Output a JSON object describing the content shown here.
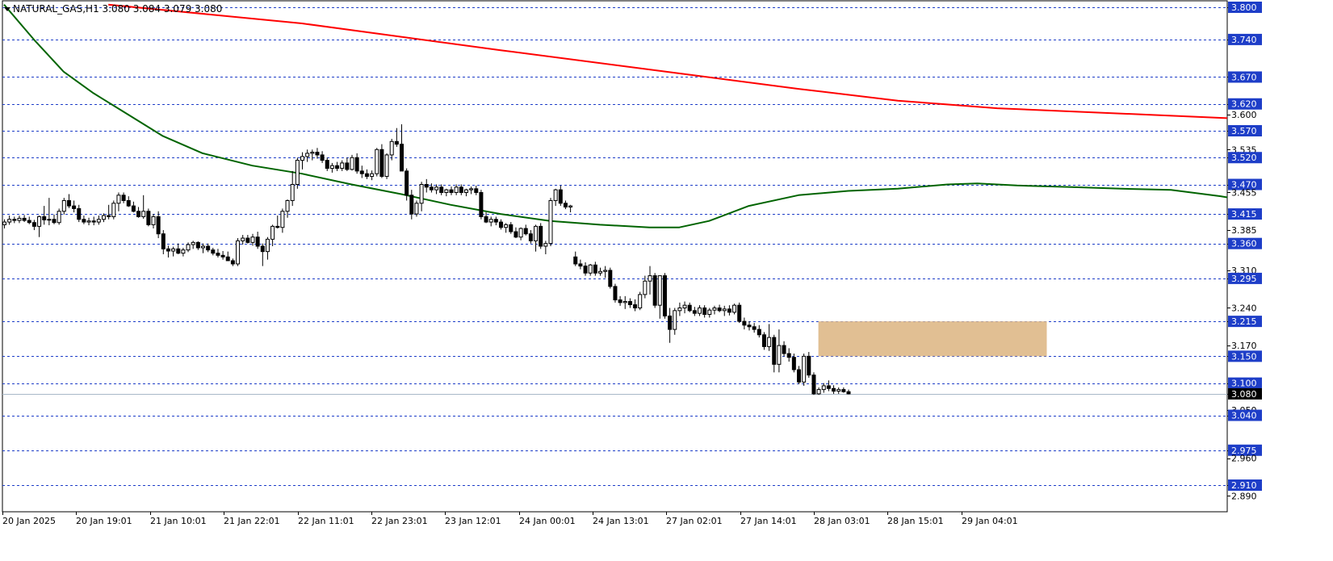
{
  "chart_data": {
    "type": "candlestick",
    "title": "NATURAL_GAS,H1",
    "ohlc_header": "3.080 3.084 3.079 3.080",
    "title_text": "NATURAL_GAS,H1  3.080 3.084 3.079 3.080",
    "ylim": [
      2.87,
      3.805
    ],
    "y_ticks": [
      "3.800",
      "3.740",
      "3.670",
      "3.620",
      "3.600",
      "3.570",
      "3.535",
      "3.520",
      "3.470",
      "3.455",
      "3.415",
      "3.385",
      "3.360",
      "3.310",
      "3.295",
      "3.240",
      "3.215",
      "3.170",
      "3.150",
      "3.100",
      "3.080",
      "3.050",
      "3.040",
      "2.975",
      "2.960",
      "2.910",
      "2.890"
    ],
    "level_lines": [
      "3.800",
      "3.740",
      "3.670",
      "3.620",
      "3.570",
      "3.520",
      "3.470",
      "3.415",
      "3.360",
      "3.295",
      "3.215",
      "3.150",
      "3.100",
      "3.040",
      "2.975",
      "2.910"
    ],
    "current_price": "3.080",
    "x_labels": [
      "20 Jan 2025",
      "20 Jan 19:01",
      "21 Jan 10:01",
      "21 Jan 22:01",
      "22 Jan 11:01",
      "22 Jan 23:01",
      "23 Jan 12:01",
      "24 Jan 00:01",
      "24 Jan 13:01",
      "27 Jan 02:01",
      "27 Jan 14:01",
      "28 Jan 03:01",
      "28 Jan 15:01",
      "29 Jan 04:01"
    ],
    "zone": {
      "low": 3.15,
      "high": 3.215,
      "start_bar": 164,
      "end_bar": 210,
      "color": "#deb887"
    },
    "series": [
      {
        "name": "",
        "color": "#ff0000",
        "role": "slow-moving-average",
        "points": [
          [
            21,
            3.805
          ],
          [
            60,
            3.77
          ],
          [
            100,
            3.72
          ],
          [
            140,
            3.672
          ],
          [
            160,
            3.648
          ],
          [
            180,
            3.626
          ],
          [
            200,
            3.612
          ],
          [
            230,
            3.6
          ],
          [
            260,
            3.588
          ],
          [
            300,
            3.575
          ],
          [
            340,
            3.56
          ],
          [
            380,
            3.543
          ],
          [
            410,
            3.53
          ],
          [
            430,
            3.512
          ],
          [
            460,
            3.49
          ],
          [
            480,
            3.475
          ],
          [
            500,
            3.462
          ],
          [
            520,
            3.45
          ],
          [
            560,
            3.426
          ],
          [
            600,
            3.4
          ],
          [
            640,
            3.37
          ]
        ]
      },
      {
        "name": "",
        "color": "#006400",
        "role": "fast-moving-average",
        "points": [
          [
            0,
            3.805
          ],
          [
            6,
            3.74
          ],
          [
            12,
            3.68
          ],
          [
            18,
            3.64
          ],
          [
            25,
            3.6
          ],
          [
            32,
            3.56
          ],
          [
            40,
            3.528
          ],
          [
            50,
            3.505
          ],
          [
            60,
            3.49
          ],
          [
            70,
            3.47
          ],
          [
            80,
            3.452
          ],
          [
            90,
            3.432
          ],
          [
            100,
            3.415
          ],
          [
            110,
            3.402
          ],
          [
            120,
            3.395
          ],
          [
            130,
            3.39
          ],
          [
            136,
            3.39
          ],
          [
            142,
            3.402
          ],
          [
            150,
            3.43
          ],
          [
            160,
            3.45
          ],
          [
            170,
            3.458
          ],
          [
            180,
            3.462
          ],
          [
            190,
            3.47
          ],
          [
            196,
            3.472
          ],
          [
            204,
            3.468
          ],
          [
            215,
            3.465
          ],
          [
            225,
            3.462
          ],
          [
            235,
            3.46
          ],
          [
            245,
            3.448
          ],
          [
            255,
            3.432
          ],
          [
            262,
            3.42
          ],
          [
            270,
            3.418
          ],
          [
            280,
            3.4
          ],
          [
            290,
            3.382
          ],
          [
            300,
            3.36
          ],
          [
            310,
            3.332
          ],
          [
            320,
            3.31
          ],
          [
            330,
            3.292
          ],
          [
            340,
            3.28
          ],
          [
            350,
            3.262
          ],
          [
            360,
            3.248
          ],
          [
            370,
            3.228
          ],
          [
            380,
            3.205
          ],
          [
            390,
            3.18
          ],
          [
            400,
            3.16
          ]
        ]
      }
    ],
    "candles": [
      [
        3.395,
        3.405,
        3.388,
        3.4
      ],
      [
        3.4,
        3.412,
        3.395,
        3.405
      ],
      [
        3.405,
        3.41,
        3.398,
        3.403
      ],
      [
        3.403,
        3.412,
        3.398,
        3.407
      ],
      [
        3.407,
        3.413,
        3.4,
        3.403
      ],
      [
        3.403,
        3.41,
        3.396,
        3.399
      ],
      [
        3.399,
        3.404,
        3.385,
        3.392
      ],
      [
        3.392,
        3.412,
        3.372,
        3.41
      ],
      [
        3.41,
        3.43,
        3.395,
        3.404
      ],
      [
        3.404,
        3.445,
        3.394,
        3.405
      ],
      [
        3.405,
        3.414,
        3.396,
        3.399
      ],
      [
        3.399,
        3.425,
        3.395,
        3.42
      ],
      [
        3.42,
        3.445,
        3.414,
        3.44
      ],
      [
        3.44,
        3.452,
        3.426,
        3.43
      ],
      [
        3.43,
        3.44,
        3.418,
        3.425
      ],
      [
        3.425,
        3.432,
        3.4,
        3.405
      ],
      [
        3.405,
        3.412,
        3.396,
        3.4
      ],
      [
        3.4,
        3.408,
        3.394,
        3.402
      ],
      [
        3.402,
        3.41,
        3.394,
        3.4
      ],
      [
        3.4,
        3.412,
        3.395,
        3.405
      ],
      [
        3.405,
        3.416,
        3.4,
        3.412
      ],
      [
        3.412,
        3.432,
        3.405,
        3.41
      ],
      [
        3.41,
        3.44,
        3.405,
        3.435
      ],
      [
        3.435,
        3.455,
        3.42,
        3.45
      ],
      [
        3.45,
        3.455,
        3.435,
        3.44
      ],
      [
        3.44,
        3.448,
        3.428,
        3.43
      ],
      [
        3.43,
        3.438,
        3.418,
        3.42
      ],
      [
        3.42,
        3.428,
        3.408,
        3.41
      ],
      [
        3.41,
        3.45,
        3.406,
        3.42
      ],
      [
        3.42,
        3.425,
        3.392,
        3.395
      ],
      [
        3.395,
        3.415,
        3.388,
        3.41
      ],
      [
        3.41,
        3.42,
        3.37,
        3.378
      ],
      [
        3.378,
        3.385,
        3.34,
        3.35
      ],
      [
        3.35,
        3.356,
        3.334,
        3.346
      ],
      [
        3.346,
        3.354,
        3.336,
        3.35
      ],
      [
        3.35,
        3.36,
        3.34,
        3.342
      ],
      [
        3.342,
        3.352,
        3.336,
        3.348
      ],
      [
        3.348,
        3.362,
        3.344,
        3.358
      ],
      [
        3.358,
        3.365,
        3.35,
        3.362
      ],
      [
        3.362,
        3.364,
        3.348,
        3.352
      ],
      [
        3.352,
        3.36,
        3.342,
        3.355
      ],
      [
        3.355,
        3.36,
        3.344,
        3.348
      ],
      [
        3.348,
        3.352,
        3.338,
        3.342
      ],
      [
        3.342,
        3.35,
        3.334,
        3.338
      ],
      [
        3.338,
        3.346,
        3.33,
        3.335
      ],
      [
        3.335,
        3.345,
        3.328,
        3.328
      ],
      [
        3.328,
        3.332,
        3.318,
        3.322
      ],
      [
        3.322,
        3.37,
        3.318,
        3.365
      ],
      [
        3.365,
        3.376,
        3.358,
        3.37
      ],
      [
        3.37,
        3.376,
        3.36,
        3.362
      ],
      [
        3.362,
        3.378,
        3.356,
        3.372
      ],
      [
        3.372,
        3.382,
        3.35,
        3.355
      ],
      [
        3.355,
        3.36,
        3.318,
        3.345
      ],
      [
        3.345,
        3.372,
        3.33,
        3.368
      ],
      [
        3.368,
        3.395,
        3.355,
        3.392
      ],
      [
        3.392,
        3.412,
        3.388,
        3.39
      ],
      [
        3.39,
        3.425,
        3.38,
        3.42
      ],
      [
        3.42,
        3.442,
        3.408,
        3.44
      ],
      [
        3.44,
        3.495,
        3.43,
        3.47
      ],
      [
        3.47,
        3.52,
        3.462,
        3.515
      ],
      [
        3.515,
        3.53,
        3.498,
        3.522
      ],
      [
        3.522,
        3.535,
        3.512,
        3.528
      ],
      [
        3.528,
        3.535,
        3.515,
        3.53
      ],
      [
        3.53,
        3.538,
        3.518,
        3.525
      ],
      [
        3.525,
        3.532,
        3.51,
        3.515
      ],
      [
        3.515,
        3.52,
        3.495,
        3.5
      ],
      [
        3.5,
        3.51,
        3.492,
        3.505
      ],
      [
        3.505,
        3.512,
        3.495,
        3.5
      ],
      [
        3.5,
        3.515,
        3.495,
        3.51
      ],
      [
        3.51,
        3.52,
        3.495,
        3.498
      ],
      [
        3.498,
        3.525,
        3.496,
        3.52
      ],
      [
        3.52,
        3.528,
        3.49,
        3.495
      ],
      [
        3.495,
        3.505,
        3.482,
        3.49
      ],
      [
        3.49,
        3.498,
        3.48,
        3.485
      ],
      [
        3.485,
        3.496,
        3.478,
        3.49
      ],
      [
        3.49,
        3.538,
        3.485,
        3.535
      ],
      [
        3.535,
        3.545,
        3.482,
        3.485
      ],
      [
        3.485,
        3.528,
        3.48,
        3.525
      ],
      [
        3.525,
        3.555,
        3.515,
        3.55
      ],
      [
        3.55,
        3.575,
        3.54,
        3.545
      ],
      [
        3.545,
        3.582,
        3.52,
        3.495
      ],
      [
        3.495,
        3.5,
        3.44,
        3.45
      ],
      [
        3.45,
        3.46,
        3.405,
        3.415
      ],
      [
        3.415,
        3.44,
        3.41,
        3.435
      ],
      [
        3.435,
        3.475,
        3.42,
        3.47
      ],
      [
        3.47,
        3.48,
        3.455,
        3.465
      ],
      [
        3.465,
        3.472,
        3.455,
        3.46
      ],
      [
        3.46,
        3.47,
        3.452,
        3.465
      ],
      [
        3.465,
        3.47,
        3.45,
        3.455
      ],
      [
        3.455,
        3.462,
        3.448,
        3.46
      ],
      [
        3.46,
        3.466,
        3.45,
        3.455
      ],
      [
        3.455,
        3.47,
        3.45,
        3.465
      ],
      [
        3.465,
        3.47,
        3.45,
        3.455
      ],
      [
        3.455,
        3.462,
        3.448,
        3.46
      ],
      [
        3.46,
        3.466,
        3.452,
        3.462
      ],
      [
        3.462,
        3.468,
        3.45,
        3.455
      ],
      [
        3.455,
        3.46,
        3.405,
        3.41
      ],
      [
        3.41,
        3.418,
        3.398,
        3.4
      ],
      [
        3.4,
        3.41,
        3.392,
        3.405
      ],
      [
        3.405,
        3.41,
        3.394,
        3.4
      ],
      [
        3.4,
        3.405,
        3.386,
        3.39
      ],
      [
        3.39,
        3.398,
        3.38,
        3.395
      ],
      [
        3.395,
        3.4,
        3.378,
        3.382
      ],
      [
        3.382,
        3.39,
        3.37,
        3.372
      ],
      [
        3.372,
        3.39,
        3.366,
        3.388
      ],
      [
        3.388,
        3.395,
        3.375,
        3.378
      ],
      [
        3.378,
        3.385,
        3.36,
        3.365
      ],
      [
        3.365,
        3.395,
        3.345,
        3.392
      ],
      [
        3.392,
        3.398,
        3.35,
        3.355
      ],
      [
        3.355,
        3.365,
        3.34,
        3.36
      ],
      [
        3.36,
        3.445,
        3.355,
        3.44
      ],
      [
        3.44,
        3.462,
        3.43,
        3.46
      ],
      [
        3.46,
        3.468,
        3.43,
        3.435
      ],
      [
        3.435,
        3.44,
        3.424,
        3.428
      ],
      [
        3.428,
        3.432,
        3.418,
        3.43
      ],
      [
        3.335,
        3.345,
        3.318,
        3.322
      ],
      [
        3.322,
        3.33,
        3.312,
        3.318
      ],
      [
        3.318,
        3.325,
        3.3,
        3.305
      ],
      [
        3.305,
        3.322,
        3.3,
        3.32
      ],
      [
        3.32,
        3.326,
        3.3,
        3.305
      ],
      [
        3.305,
        3.315,
        3.3,
        3.308
      ],
      [
        3.308,
        3.318,
        3.296,
        3.31
      ],
      [
        3.31,
        3.315,
        3.276,
        3.28
      ],
      [
        3.28,
        3.285,
        3.25,
        3.255
      ],
      [
        3.255,
        3.262,
        3.244,
        3.25
      ],
      [
        3.25,
        3.262,
        3.238,
        3.252
      ],
      [
        3.252,
        3.258,
        3.24,
        3.246
      ],
      [
        3.246,
        3.256,
        3.234,
        3.24
      ],
      [
        3.24,
        3.27,
        3.236,
        3.265
      ],
      [
        3.265,
        3.3,
        3.258,
        3.29
      ],
      [
        3.29,
        3.318,
        3.265,
        3.3
      ],
      [
        3.3,
        3.305,
        3.24,
        3.245
      ],
      [
        3.245,
        3.3,
        3.22,
        3.3
      ],
      [
        3.3,
        3.305,
        3.22,
        3.225
      ],
      [
        3.225,
        3.24,
        3.175,
        3.2
      ],
      [
        3.2,
        3.24,
        3.19,
        3.235
      ],
      [
        3.235,
        3.25,
        3.225,
        3.24
      ],
      [
        3.24,
        3.252,
        3.23,
        3.245
      ],
      [
        3.245,
        3.25,
        3.232,
        3.235
      ],
      [
        3.235,
        3.242,
        3.225,
        3.23
      ],
      [
        3.23,
        3.245,
        3.225,
        3.24
      ],
      [
        3.24,
        3.245,
        3.222,
        3.228
      ],
      [
        3.228,
        3.24,
        3.222,
        3.236
      ],
      [
        3.236,
        3.244,
        3.228,
        3.24
      ],
      [
        3.24,
        3.246,
        3.232,
        3.235
      ],
      [
        3.235,
        3.244,
        3.225,
        3.238
      ],
      [
        3.238,
        3.245,
        3.226,
        3.232
      ],
      [
        3.232,
        3.248,
        3.228,
        3.245
      ],
      [
        3.245,
        3.25,
        3.212,
        3.215
      ],
      [
        3.215,
        3.222,
        3.2,
        3.208
      ],
      [
        3.208,
        3.215,
        3.198,
        3.205
      ],
      [
        3.205,
        3.212,
        3.194,
        3.2
      ],
      [
        3.2,
        3.208,
        3.185,
        3.19
      ],
      [
        3.19,
        3.195,
        3.162,
        3.168
      ],
      [
        3.168,
        3.21,
        3.16,
        3.185
      ],
      [
        3.185,
        3.19,
        3.12,
        3.135
      ],
      [
        3.135,
        3.2,
        3.12,
        3.17
      ],
      [
        3.17,
        3.178,
        3.15,
        3.155
      ],
      [
        3.155,
        3.165,
        3.14,
        3.148
      ],
      [
        3.148,
        3.155,
        3.12,
        3.125
      ],
      [
        3.125,
        3.132,
        3.098,
        3.102
      ],
      [
        3.102,
        3.155,
        3.095,
        3.15
      ],
      [
        3.15,
        3.158,
        3.11,
        3.115
      ],
      [
        3.115,
        3.12,
        3.078,
        3.08
      ],
      [
        3.08,
        3.092,
        3.078,
        3.088
      ],
      [
        3.088,
        3.1,
        3.082,
        3.095
      ],
      [
        3.095,
        3.105,
        3.085,
        3.09
      ],
      [
        3.09,
        3.096,
        3.08,
        3.085
      ],
      [
        3.085,
        3.092,
        3.08,
        3.088
      ],
      [
        3.088,
        3.092,
        3.082,
        3.084
      ],
      [
        3.084,
        3.088,
        3.079,
        3.08
      ]
    ]
  }
}
